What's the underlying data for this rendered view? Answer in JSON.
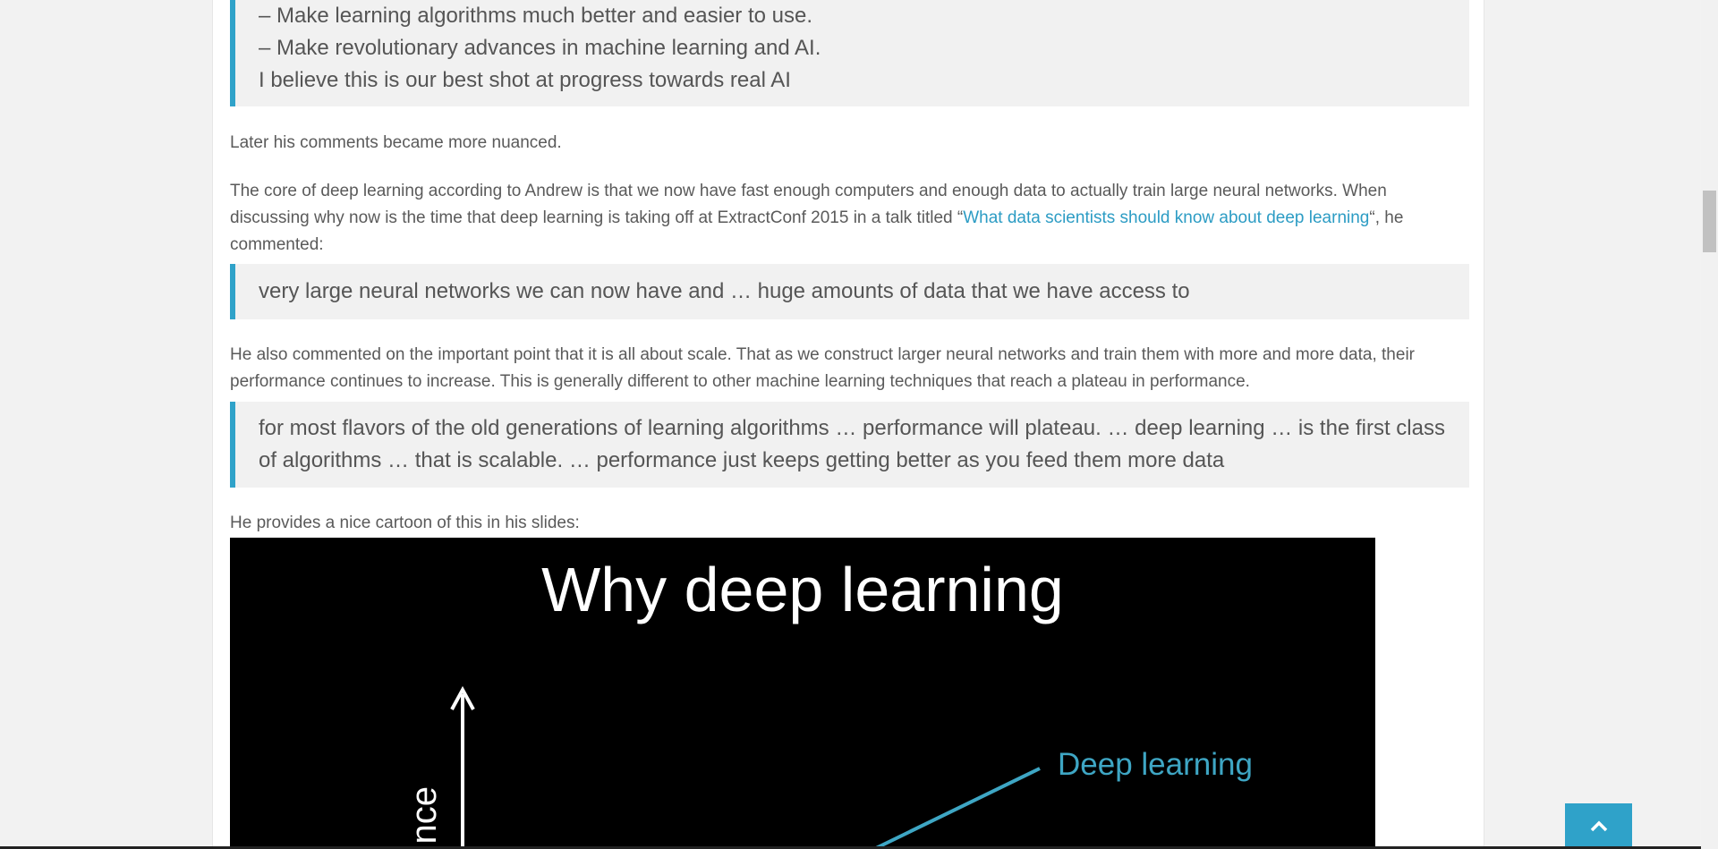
{
  "quote1": {
    "lines": [
      "– Make learning algorithms much better and easier to use.",
      "– Make revolutionary advances in machine learning and AI.",
      "I believe this is our best shot at progress towards real AI"
    ]
  },
  "para1": "Later his comments became more nuanced.",
  "para2": {
    "before": "The core of deep learning according to Andrew is that we now have fast enough computers and enough data to actually train large neural networks. When discussing why now is the time that deep learning is taking off at ExtractConf 2015 in a talk titled “",
    "link": "What data scientists should know about deep learning",
    "after": "“, he commented:"
  },
  "quote2": "very large neural networks we can now have and … huge amounts of data that we have access to",
  "para3": "He also commented on the important point that it is all about scale. That as we construct larger neural networks and train them with more and more data, their performance continues to increase. This is generally different to other machine learning techniques that reach a plateau in performance.",
  "quote3": "for most flavors of the old generations of learning algorithms … performance will plateau. … deep learning … is the first class of algorithms … that is scalable. … performance just keeps getting better as you feed them more data",
  "para4": "He provides a nice cartoon of this in his slides:",
  "slide": {
    "title": "Why deep learning",
    "series_label": "Deep learning",
    "axis_label_partial": "nce",
    "line_color": "#3ea6c4"
  },
  "back_to_top": {
    "icon": "chevron-up-icon"
  }
}
